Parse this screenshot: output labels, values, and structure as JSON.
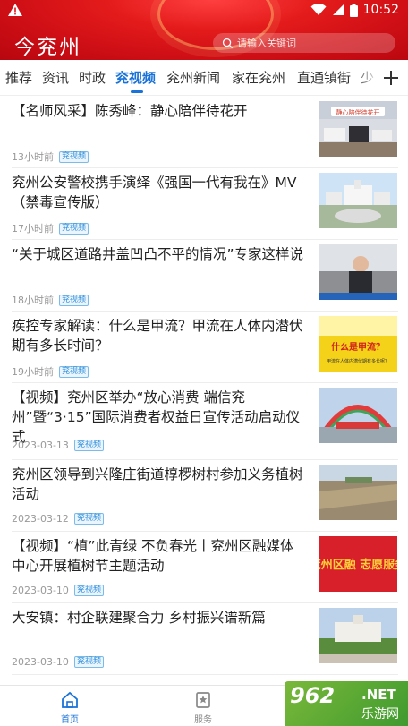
{
  "status": {
    "time": "10:52"
  },
  "app": {
    "title": "今兖州",
    "search_placeholder": "请输入关键词"
  },
  "tabs": [
    {
      "label": "推荐"
    },
    {
      "label": "资讯"
    },
    {
      "label": "时政"
    },
    {
      "label": "兖视频"
    },
    {
      "label": "兖州新闻"
    },
    {
      "label": "家在兖州"
    },
    {
      "label": "直通镇街"
    },
    {
      "label": "少"
    }
  ],
  "active_tab": "兖视频",
  "news": [
    {
      "title": "【名师风采】陈秀峰：静心陪伴待花开",
      "time": "13小时前",
      "badge": "兖视频",
      "thumb_caption": "静心陪伴待花开"
    },
    {
      "title": "兖州公安警校携手演绎《强国一代有我在》MV（禁毒宣传版）",
      "time": "17小时前",
      "badge": "兖视频"
    },
    {
      "title": "“关于城区道路井盖凹凸不平的情况”专家这样说",
      "time": "18小时前",
      "badge": "兖视频"
    },
    {
      "title": "疾控专家解读：什么是甲流？甲流在人体内潜伏期有多长时间？",
      "time": "19小时前",
      "badge": "兖视频",
      "thumb_caption": "什么是甲流？",
      "thumb_sub": "甲流在人体内潜伏期有多长呢？"
    },
    {
      "title": "【视频】兖州区举办“放心消费  端信兖州”暨“3·15”国际消费者权益日宣传活动启动仪式",
      "time": "2023-03-13",
      "badge": "兖视频"
    },
    {
      "title": "兖州区领导到兴隆庄街道椁椤树村参加义务植树活动",
      "time": "2023-03-12",
      "badge": "兖视频"
    },
    {
      "title": "【视频】“植”此青绿  不负春光丨兖州区融媒体中心开展植树节主题活动",
      "time": "2023-03-10",
      "badge": "兖视频",
      "thumb_caption": "兖州区融 志愿服务"
    },
    {
      "title": "大安镇：村企联建聚合力  乡村振兴谱新篇",
      "time": "2023-03-10",
      "badge": "兖视频"
    }
  ],
  "bottom_nav": [
    {
      "label": "首页"
    },
    {
      "label": "服务"
    }
  ],
  "watermark": {
    "number": "962",
    "suffix": ".NET",
    "cn": "乐游网"
  },
  "colors": {
    "brand_red": "#d8151c",
    "accent_blue": "#1a73d9"
  }
}
